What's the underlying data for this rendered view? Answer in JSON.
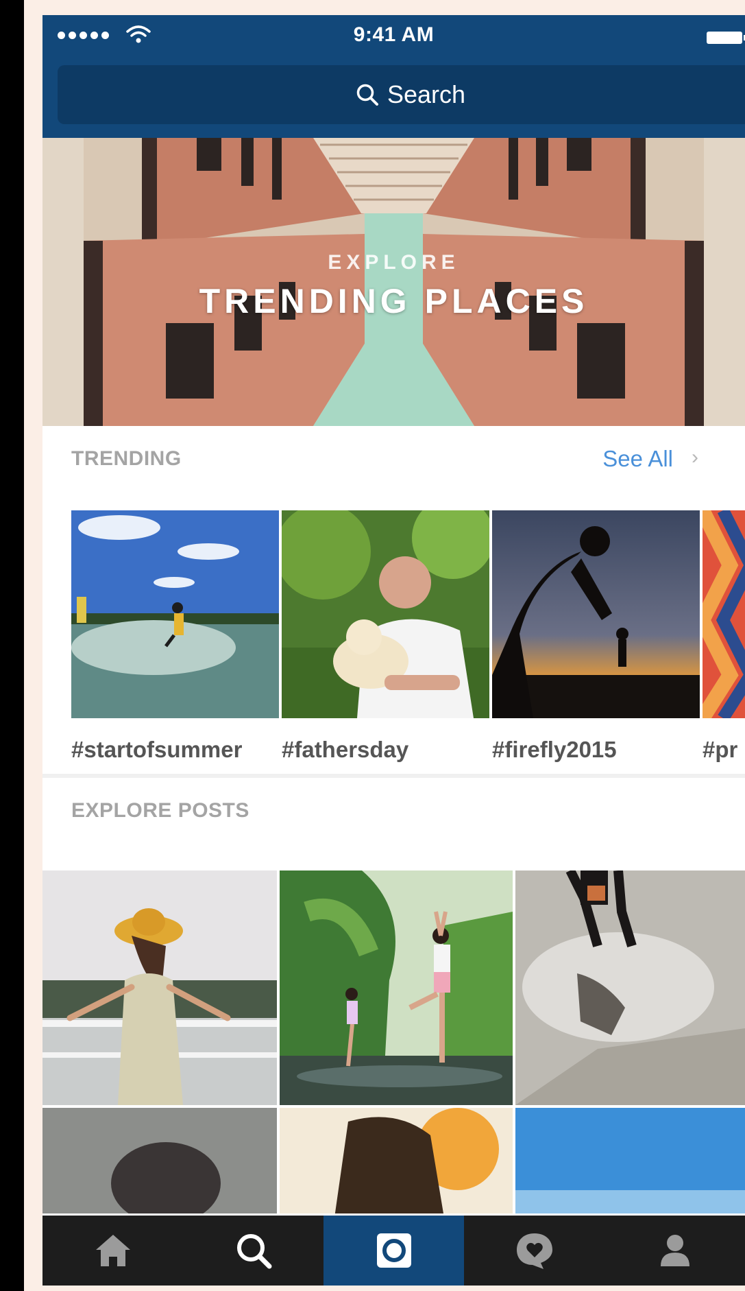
{
  "status_bar": {
    "time": "9:41 AM"
  },
  "search": {
    "label": "Search",
    "icon": "search-icon"
  },
  "hero": {
    "eyebrow": "EXPLORE",
    "title": "TRENDING PLACES"
  },
  "trending": {
    "label": "TRENDING",
    "see_all": "See All",
    "chevron": "›",
    "items": [
      {
        "tag": "#startofsummer"
      },
      {
        "tag": "#fathersday"
      },
      {
        "tag": "#firefly2015"
      },
      {
        "tag": "#pr"
      }
    ]
  },
  "explore": {
    "label": "EXPLORE POSTS"
  },
  "tabbar": {
    "tabs": [
      {
        "icon": "home-icon"
      },
      {
        "icon": "search-icon"
      },
      {
        "icon": "camera-icon"
      },
      {
        "icon": "activity-heart-icon"
      },
      {
        "icon": "profile-icon"
      }
    ]
  },
  "colors": {
    "header_bg": "#12487a",
    "search_bg": "#0d3a64",
    "link_blue": "#4a90d9",
    "tabbar_bg": "#1d1d1d",
    "tab_active_bg": "#12487a"
  }
}
